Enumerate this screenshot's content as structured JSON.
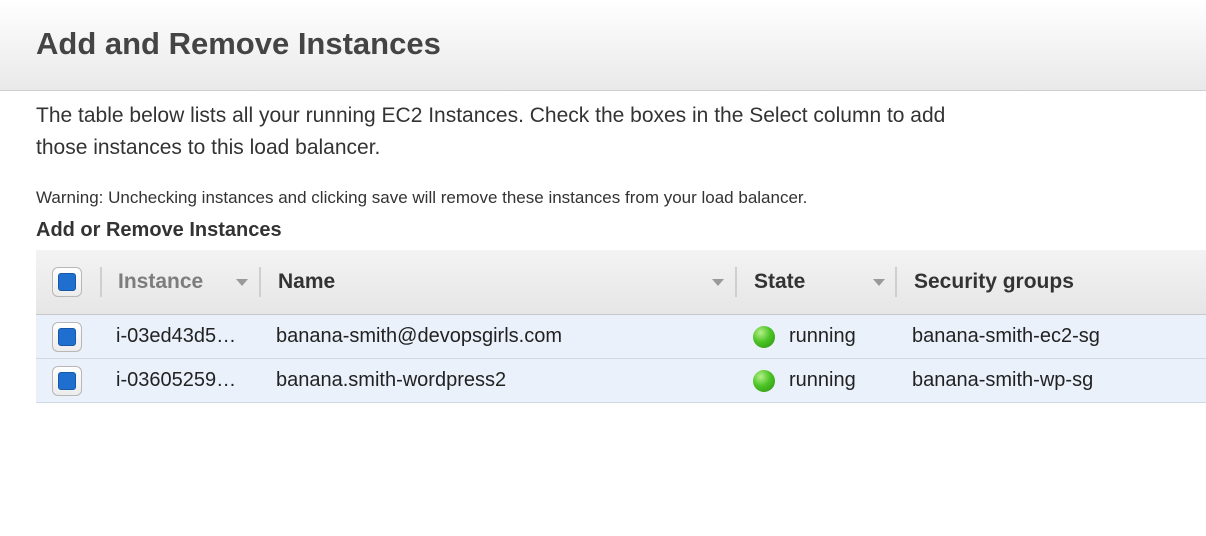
{
  "dialog": {
    "title": "Add and Remove Instances",
    "description": "The table below lists all your running EC2 Instances. Check the boxes in the Select column to add those instances to this load balancer.",
    "warning": "Warning: Unchecking instances and clicking save will remove these instances from your load balancer.",
    "section_title": "Add or Remove Instances"
  },
  "table": {
    "columns": {
      "instance": "Instance",
      "name": "Name",
      "state": "State",
      "security_groups": "Security groups"
    },
    "select_all_checked": true,
    "rows": [
      {
        "checked": true,
        "instance": "i-03ed43d5…",
        "name": "banana-smith@devopsgirls.com",
        "state": "running",
        "security_groups": "banana-smith-ec2-sg"
      },
      {
        "checked": true,
        "instance": "i-03605259…",
        "name": "banana.smith-wordpress2",
        "state": "running",
        "security_groups": "banana-smith-wp-sg"
      }
    ]
  },
  "icons": {
    "sort": "chevron-down-icon",
    "status": "status-running-icon",
    "checkbox": "checkbox-checked-icon"
  },
  "colors": {
    "row_selected_bg": "#eaf1fb",
    "checkbox_fill": "#1e6fcf",
    "status_running": "#4cc425"
  }
}
